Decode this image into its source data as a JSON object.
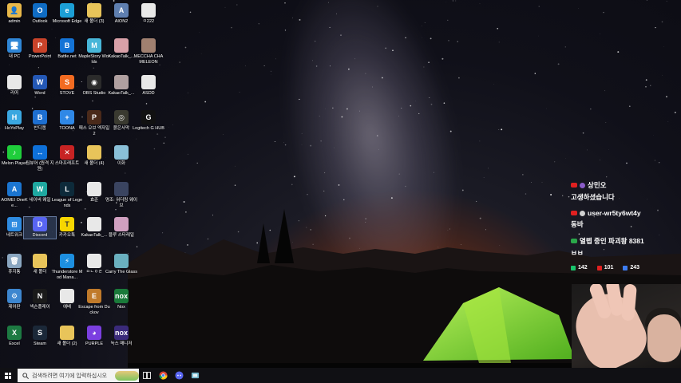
{
  "desktop_icons": [
    {
      "label": "admin",
      "icon": "folder-user-icon",
      "color": "#e8b84a",
      "glyph": "👤",
      "col": 0,
      "row": 0
    },
    {
      "label": "내 PC",
      "icon": "computer-icon",
      "color": "#2f86d6",
      "glyph": "🖥",
      "col": 0,
      "row": 1
    },
    {
      "label": "리어",
      "icon": "document-icon",
      "color": "#e8e8e8",
      "glyph": "",
      "col": 0,
      "row": 2
    },
    {
      "label": "HoYoPlay",
      "icon": "hoyoplay-icon",
      "color": "#3aa7e0",
      "glyph": "H",
      "col": 0,
      "row": 3
    },
    {
      "label": "Melon Player",
      "icon": "melon-icon",
      "color": "#1fce3b",
      "glyph": "♪",
      "col": 0,
      "row": 4
    },
    {
      "label": "AOMEI OneKe...",
      "icon": "aomei-icon",
      "color": "#1b75d0",
      "glyph": "A",
      "col": 0,
      "row": 5
    },
    {
      "label": "네트워크",
      "icon": "network-icon",
      "color": "#2e8be0",
      "glyph": "⊞",
      "col": 0,
      "row": 6
    },
    {
      "label": "휴지통",
      "icon": "recycle-bin-icon",
      "color": "#8aa6c0",
      "glyph": "🗑",
      "col": 0,
      "row": 7
    },
    {
      "label": "제어판",
      "icon": "control-panel-icon",
      "color": "#3d86cf",
      "glyph": "⚙",
      "col": 0,
      "row": 8
    },
    {
      "label": "Excel",
      "icon": "excel-icon",
      "color": "#1d7a42",
      "glyph": "X",
      "col": 0,
      "row": 9
    },
    {
      "label": "Outlook",
      "icon": "outlook-icon",
      "color": "#0f6cc4",
      "glyph": "O",
      "col": 1,
      "row": 0
    },
    {
      "label": "PowerPoint",
      "icon": "powerpoint-icon",
      "color": "#c9432a",
      "glyph": "P",
      "col": 1,
      "row": 1
    },
    {
      "label": "Word",
      "icon": "word-icon",
      "color": "#2458b5",
      "glyph": "W",
      "col": 1,
      "row": 2
    },
    {
      "label": "반디캠",
      "icon": "bandicam-icon",
      "color": "#1e6fd0",
      "glyph": "B",
      "col": 1,
      "row": 3
    },
    {
      "label": "팀뷰어 (원격 지원)",
      "icon": "teamviewer-icon",
      "color": "#0e70d8",
      "glyph": "↔",
      "col": 1,
      "row": 4
    },
    {
      "label": "네이버 웨일",
      "icon": "whale-icon",
      "color": "#1fa8a0",
      "glyph": "W",
      "col": 1,
      "row": 5
    },
    {
      "label": "Discord",
      "icon": "discord-icon",
      "color": "#5865f2",
      "glyph": "D",
      "col": 1,
      "row": 6,
      "selected": true
    },
    {
      "label": "새 폴더",
      "icon": "folder-icon",
      "color": "#e8c45a",
      "glyph": "",
      "col": 1,
      "row": 7
    },
    {
      "label": "넥슨플레이",
      "icon": "nexon-icon",
      "color": "#1a1a1a",
      "glyph": "N",
      "col": 1,
      "row": 8
    },
    {
      "label": "Steam",
      "icon": "steam-icon",
      "color": "#1b2838",
      "glyph": "S",
      "col": 1,
      "row": 9
    },
    {
      "label": "Microsoft Edge",
      "icon": "edge-icon",
      "color": "#1c9fd6",
      "glyph": "e",
      "col": 2,
      "row": 0
    },
    {
      "label": "Battle.net",
      "icon": "battlenet-icon",
      "color": "#1473d6",
      "glyph": "B",
      "col": 2,
      "row": 1
    },
    {
      "label": "STOVE",
      "icon": "stove-icon",
      "color": "#f26b21",
      "glyph": "S",
      "col": 2,
      "row": 2
    },
    {
      "label": "TOONA",
      "icon": "toona-icon",
      "color": "#2f88e6",
      "glyph": "+",
      "col": 2,
      "row": 3
    },
    {
      "label": "스마프래프트",
      "icon": "game-icon",
      "color": "#c72323",
      "glyph": "✕",
      "col": 2,
      "row": 4
    },
    {
      "label": "League of Legends",
      "icon": "lol-icon",
      "color": "#0d2a3a",
      "glyph": "L",
      "col": 2,
      "row": 5
    },
    {
      "label": "카카오톡",
      "icon": "kakaotalk-icon",
      "color": "#f7d600",
      "glyph": "T",
      "col": 2,
      "row": 6
    },
    {
      "label": "Thunderstore Mod Mana...",
      "icon": "thunderstore-icon",
      "color": "#1d8fe0",
      "glyph": "⚡",
      "col": 2,
      "row": 7
    },
    {
      "label": "예배",
      "icon": "document-icon",
      "color": "#e8e8e8",
      "glyph": "",
      "col": 2,
      "row": 8
    },
    {
      "label": "새 폴더 (2)",
      "icon": "folder-icon",
      "color": "#e8c45a",
      "glyph": "",
      "col": 2,
      "row": 9
    },
    {
      "label": "새 폴더 (3)",
      "icon": "folder-icon",
      "color": "#e8c45a",
      "glyph": "",
      "col": 3,
      "row": 0
    },
    {
      "label": "MapleStory Worlds",
      "icon": "maplestory-icon",
      "color": "#48b6d8",
      "glyph": "M",
      "col": 3,
      "row": 1
    },
    {
      "label": "OBS Studio",
      "icon": "obs-icon",
      "color": "#2b2b2b",
      "glyph": "◉",
      "col": 3,
      "row": 2
    },
    {
      "label": "패스 오브 엑자일2",
      "icon": "poe-icon",
      "color": "#4a2a1a",
      "glyph": "P",
      "col": 3,
      "row": 3
    },
    {
      "label": "새 폴더 (4)",
      "icon": "folder-icon",
      "color": "#e8c45a",
      "glyph": "",
      "col": 3,
      "row": 4
    },
    {
      "label": "효준",
      "icon": "document-icon",
      "color": "#e8e8e8",
      "glyph": "",
      "col": 3,
      "row": 5
    },
    {
      "label": "KakaoTalk_...",
      "icon": "image-icon",
      "color": "#e8e8e8",
      "glyph": "",
      "col": 3,
      "row": 6
    },
    {
      "label": "ㅁㄴㅇㄹ",
      "icon": "document-icon",
      "color": "#e8e8e8",
      "glyph": "",
      "col": 3,
      "row": 7
    },
    {
      "label": "Escape from Duckov",
      "icon": "duckov-icon",
      "color": "#c07a2a",
      "glyph": "E",
      "col": 3,
      "row": 8
    },
    {
      "label": "PURPLE",
      "icon": "purple-icon",
      "color": "#7b3fe0",
      "glyph": "◕",
      "col": 3,
      "row": 9
    },
    {
      "label": "AION2",
      "icon": "aion-icon",
      "color": "#5f7fb0",
      "glyph": "A",
      "col": 4,
      "row": 0
    },
    {
      "label": "KakaoTalk_...",
      "icon": "photo-icon",
      "color": "#d8a0a8",
      "glyph": "",
      "col": 4,
      "row": 1
    },
    {
      "label": "KakaoTalk_...",
      "icon": "photo-icon",
      "color": "#b0a0a0",
      "glyph": "",
      "col": 4,
      "row": 2
    },
    {
      "label": "붉은사막",
      "icon": "crimson-desert-icon",
      "color": "#3a3a30",
      "glyph": "◎",
      "col": 4,
      "row": 3
    },
    {
      "label": "이화",
      "icon": "character-icon",
      "color": "#8ac0d8",
      "glyph": "",
      "col": 4,
      "row": 4
    },
    {
      "label": "명조: 워더링 웨이브",
      "icon": "wuthering-icon",
      "color": "#3a4460",
      "glyph": "",
      "col": 4,
      "row": 5
    },
    {
      "label": "블루 스타레일",
      "icon": "character-icon",
      "color": "#d0a0c0",
      "glyph": "",
      "col": 4,
      "row": 6
    },
    {
      "label": "Carry The Glass",
      "icon": "game-icon",
      "color": "#6ab0c0",
      "glyph": "",
      "col": 4,
      "row": 7
    },
    {
      "label": "Nox",
      "icon": "nox-icon",
      "color": "#1a7a3a",
      "glyph": "nox",
      "col": 4,
      "row": 8
    },
    {
      "label": "녹스 매니저",
      "icon": "nox-icon",
      "color": "#3a2a7a",
      "glyph": "nox",
      "col": 4,
      "row": 9
    },
    {
      "label": "ㅁ222",
      "icon": "document-icon",
      "color": "#e8e8e8",
      "glyph": "",
      "col": 5,
      "row": 0
    },
    {
      "label": "MECCHA CHAMELEON",
      "icon": "chameleon-icon",
      "color": "#a08070",
      "glyph": "",
      "col": 5,
      "row": 1
    },
    {
      "label": "ASDD",
      "icon": "document-icon",
      "color": "#e8e8e8",
      "glyph": "",
      "col": 5,
      "row": 2
    },
    {
      "label": "Logitech G HUB",
      "icon": "logitech-icon",
      "color": "#111111",
      "glyph": "G",
      "col": 5,
      "row": 3
    }
  ],
  "chat": {
    "messages": [
      {
        "author": "상민오",
        "text": "고생하셨습니다",
        "avatar_color": "#8a5cc8"
      },
      {
        "author": "user-wr5ty6wt4y",
        "text": "동바",
        "avatar_color": "#d0d0d0"
      },
      {
        "author": "열렙 중인 파괴왕 8381",
        "text": "ㅂㅂ",
        "avatar_color": "#2aa84a"
      }
    ],
    "stats": [
      {
        "icon": "chzzk-icon",
        "value": "142",
        "color": "#19c36b"
      },
      {
        "icon": "youtube-icon",
        "value": "101",
        "color": "#e02020"
      },
      {
        "icon": "soop-icon",
        "value": "243",
        "color": "#3d7cf0"
      }
    ]
  },
  "taskbar": {
    "search_placeholder": "검색하려면 여기에 입력하십시오",
    "apps": [
      "task-view-icon",
      "chrome-icon",
      "discord-icon",
      "app-icon"
    ]
  }
}
